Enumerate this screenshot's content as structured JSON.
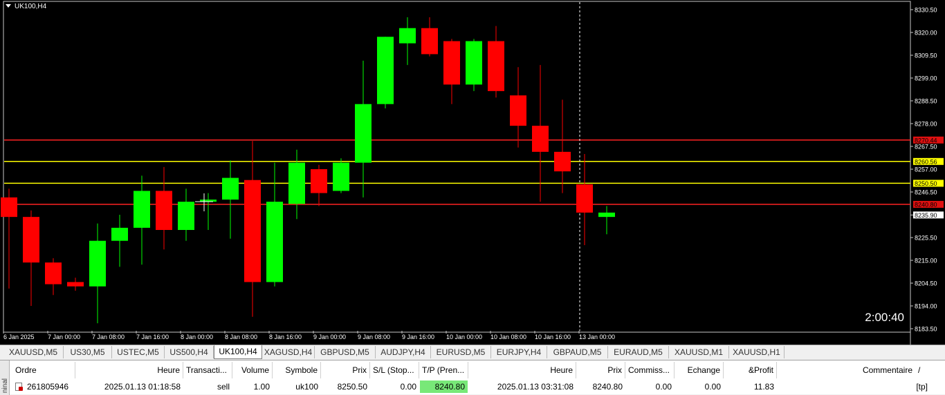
{
  "chart": {
    "title": "UK100,H4",
    "countdown": "2:00:40",
    "y_ticks": [
      "8330.50",
      "8320.00",
      "8309.50",
      "8299.00",
      "8288.50",
      "8278.00",
      "8267.50",
      "8257.00",
      "8246.50",
      "8235.90",
      "8225.50",
      "8215.00",
      "8204.50",
      "8194.00",
      "8183.50"
    ],
    "x_ticks": [
      "6 Jan 2025",
      "7 Jan 00:00",
      "7 Jan 08:00",
      "7 Jan 16:00",
      "8 Jan 00:00",
      "8 Jan 08:00",
      "8 Jan 16:00",
      "9 Jan 00:00",
      "9 Jan 08:00",
      "9 Jan 16:00",
      "10 Jan 00:00",
      "10 Jan 08:00",
      "10 Jan 16:00",
      "13 Jan 00:00"
    ],
    "current_price_label": "8235.90",
    "levels": [
      {
        "label": "8270.44",
        "price": 8270.44,
        "color": "#ff2222",
        "label_bg": "#e01010",
        "label_fg": "#000000"
      },
      {
        "label": "8260.56",
        "price": 8260.56,
        "color": "#ffff00",
        "label_bg": "#ffff00",
        "label_fg": "#000000"
      },
      {
        "label": "8250.50",
        "price": 8250.5,
        "color": "#ffff00",
        "label_bg": "#ffff00",
        "label_fg": "#000000"
      },
      {
        "label": "8240.80",
        "price": 8240.8,
        "color": "#ff2222",
        "label_bg": "#e01010",
        "label_fg": "#000000"
      }
    ],
    "colors": {
      "bull": "#00ff00",
      "bear": "#ff0000",
      "background": "#000000",
      "text": "#ffffff"
    },
    "candles": [
      {
        "o": 8244,
        "h": 8248,
        "l": 8202,
        "c": 8235
      },
      {
        "o": 8235,
        "h": 8238,
        "l": 8194,
        "c": 8214
      },
      {
        "o": 8214,
        "h": 8216,
        "l": 8199,
        "c": 8204
      },
      {
        "o": 8205,
        "h": 8207,
        "l": 8201,
        "c": 8203
      },
      {
        "o": 8203,
        "h": 8232,
        "l": 8186,
        "c": 8224
      },
      {
        "o": 8224,
        "h": 8236,
        "l": 8212,
        "c": 8230
      },
      {
        "o": 8230,
        "h": 8254,
        "l": 8213,
        "c": 8247
      },
      {
        "o": 8247,
        "h": 8258,
        "l": 8220,
        "c": 8229
      },
      {
        "o": 8229,
        "h": 8248,
        "l": 8224,
        "c": 8242
      },
      {
        "o": 8242,
        "h": 8246,
        "l": 8229,
        "c": 8243
      },
      {
        "o": 8243,
        "h": 8261,
        "l": 8225,
        "c": 8253
      },
      {
        "o": 8252,
        "h": 8270,
        "l": 8189,
        "c": 8205
      },
      {
        "o": 8205,
        "h": 8260,
        "l": 8203,
        "c": 8242
      },
      {
        "o": 8241,
        "h": 8266,
        "l": 8234,
        "c": 8260
      },
      {
        "o": 8257,
        "h": 8259,
        "l": 8240,
        "c": 8246
      },
      {
        "o": 8247,
        "h": 8262,
        "l": 8246,
        "c": 8260
      },
      {
        "o": 8260,
        "h": 8307,
        "l": 8244,
        "c": 8287
      },
      {
        "o": 8287,
        "h": 8318,
        "l": 8285,
        "c": 8318
      },
      {
        "o": 8315,
        "h": 8327,
        "l": 8305,
        "c": 8322
      },
      {
        "o": 8322,
        "h": 8327,
        "l": 8309,
        "c": 8310
      },
      {
        "o": 8316,
        "h": 8317,
        "l": 8287,
        "c": 8296
      },
      {
        "o": 8296,
        "h": 8317,
        "l": 8293,
        "c": 8316
      },
      {
        "o": 8316,
        "h": 8323,
        "l": 8290,
        "c": 8293
      },
      {
        "o": 8291,
        "h": 8304,
        "l": 8267,
        "c": 8277
      },
      {
        "o": 8277,
        "h": 8305,
        "l": 8242,
        "c": 8265
      },
      {
        "o": 8265,
        "h": 8289,
        "l": 8246,
        "c": 8256
      },
      {
        "o": 8250,
        "h": 8264,
        "l": 8222,
        "c": 8237
      },
      {
        "o": 8235,
        "h": 8240,
        "l": 8227,
        "c": 8237
      }
    ]
  },
  "tabs": [
    "XAUUSD,M5",
    "US30,M5",
    "USTEC,M5",
    "US500,H4",
    "UK100,H4",
    "XAGUSD,H4",
    "GBPUSD,M5",
    "AUDJPY,H4",
    "EURUSD,M5",
    "EURJPY,H4",
    "GBPAUD,M5",
    "EURAUD,M5",
    "XAUUSD,M1",
    "XAUUSD,H1"
  ],
  "active_tab": "UK100,H4",
  "terminal": {
    "side_label": "ninal",
    "headers": [
      "Ordre",
      "Heure",
      "Transacti...",
      "Volume",
      "Symbole",
      "Prix",
      "S/L (Stop...",
      "T/P (Pren...",
      "Heure",
      "Prix",
      "Commiss...",
      "Echange",
      "&Profit",
      "Commentaire",
      "/"
    ],
    "row": {
      "order": "261805946",
      "open_time": "2025.01.13 01:18:58",
      "type": "sell",
      "volume": "1.00",
      "symbol": "uk100",
      "open_price": "8250.50",
      "sl": "0.00",
      "tp": "8240.80",
      "close_time": "2025.01.13 03:31:08",
      "close_price": "8240.80",
      "commission": "0.00",
      "swap": "0.00",
      "profit": "11.83",
      "comment": "[tp]"
    }
  }
}
